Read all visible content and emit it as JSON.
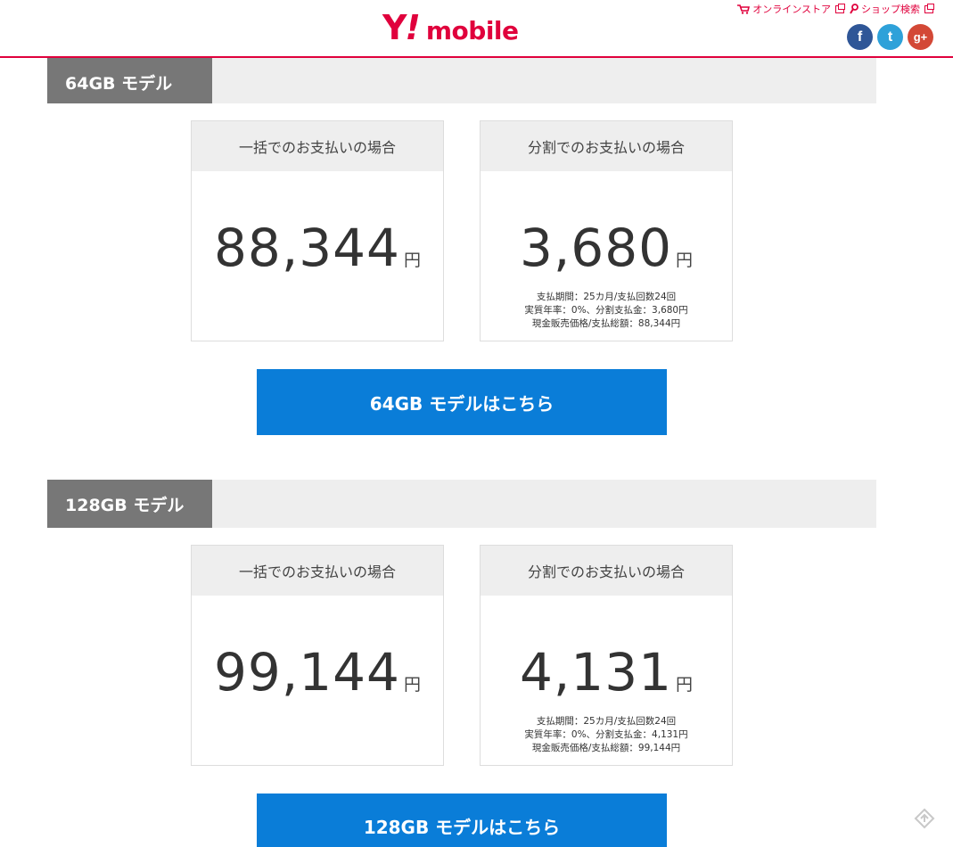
{
  "header": {
    "logo_y": "Y",
    "logo_bang": "!",
    "logo_word": "mobile",
    "online_store": "オンラインストア",
    "shop_search": "ショップ検索",
    "social": {
      "facebook": "f",
      "twitter": "t",
      "google_plus": "g+"
    }
  },
  "colors": {
    "brand": "#e0003c",
    "cta": "#0a7dd8",
    "section_label": "#777777"
  },
  "sections": [
    {
      "title": "64GB モデル",
      "lump": {
        "heading": "一括でのお支払いの場合",
        "amount": "88,344",
        "unit": "円"
      },
      "installment": {
        "heading": "分割でのお支払いの場合",
        "amount": "3,680",
        "unit": "円",
        "notes": [
          "支払期間：25カ月/支払回数24回",
          "実質年率：0%、分割支払金：3,680円",
          "現金販売価格/支払総額：88,344円"
        ]
      },
      "cta": "64GB モデルはこちら"
    },
    {
      "title": "128GB モデル",
      "lump": {
        "heading": "一括でのお支払いの場合",
        "amount": "99,144",
        "unit": "円"
      },
      "installment": {
        "heading": "分割でのお支払いの場合",
        "amount": "4,131",
        "unit": "円",
        "notes": [
          "支払期間：25カ月/支払回数24回",
          "実質年率：0%、分割支払金：4,131円",
          "現金販売価格/支払総額：99,144円"
        ]
      },
      "cta": "128GB モデルはこちら"
    }
  ]
}
